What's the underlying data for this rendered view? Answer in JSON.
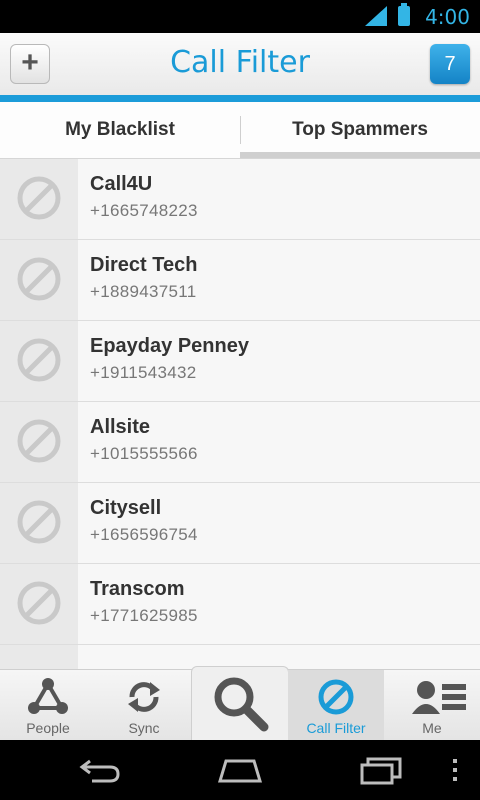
{
  "status_bar": {
    "time": "4:00"
  },
  "header": {
    "title": "Call Filter",
    "add_label": "+",
    "badge_count": "7"
  },
  "tabs": [
    {
      "label": "My Blacklist",
      "selected": false
    },
    {
      "label": "Top Spammers",
      "selected": true
    }
  ],
  "list": [
    {
      "name": "Call4U",
      "phone": "+1665748223"
    },
    {
      "name": "Direct Tech",
      "phone": "+1889437511"
    },
    {
      "name": "Epayday Penney",
      "phone": "+1911543432"
    },
    {
      "name": "Allsite",
      "phone": "+1015555566"
    },
    {
      "name": "Citysell",
      "phone": "+1656596754"
    },
    {
      "name": "Transcom",
      "phone": "+1771625985"
    }
  ],
  "bottom_nav": [
    {
      "label": "People",
      "icon": "people-network-icon"
    },
    {
      "label": "Sync",
      "icon": "sync-icon"
    },
    {
      "label": "",
      "icon": "search-icon"
    },
    {
      "label": "Call Filter",
      "icon": "block-icon",
      "active": true
    },
    {
      "label": "Me",
      "icon": "profile-icon"
    }
  ],
  "colors": {
    "accent": "#1a9bd7",
    "status_icons": "#33b5e5"
  }
}
